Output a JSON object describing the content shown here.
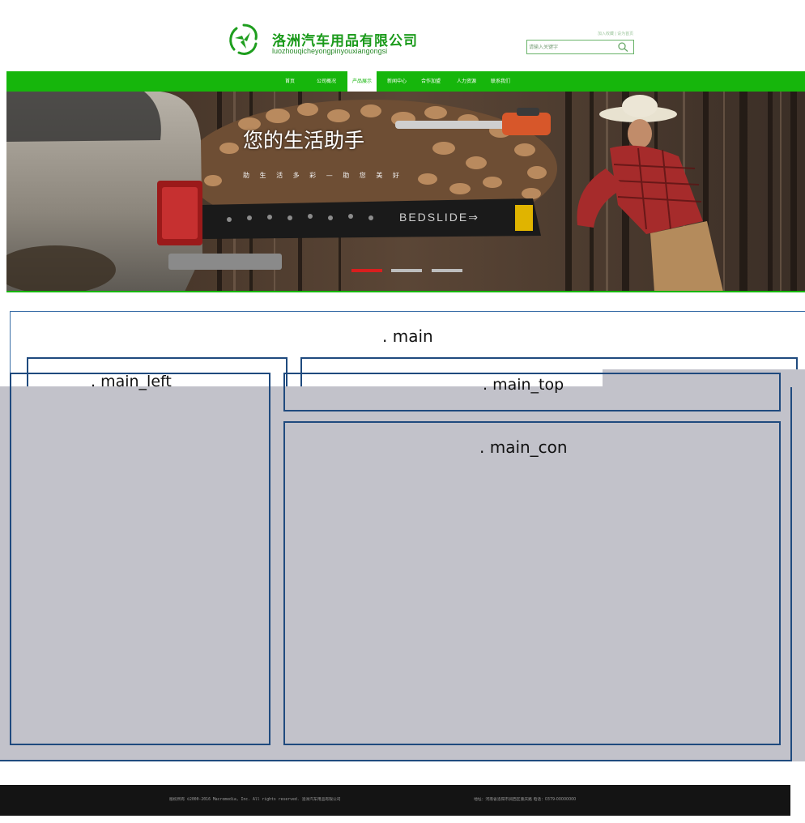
{
  "header": {
    "company_name": "洛洲汽车用品有限公司",
    "company_pinyin": "luozhouqicheyongpinyouxiangongsi",
    "top_link": "加入收藏 | 设为首页",
    "search": {
      "placeholder": "请输入关键字",
      "button_icon": "search-icon"
    },
    "logo_icon": "swirl-logo-icon"
  },
  "nav": {
    "items": [
      {
        "label": "首页"
      },
      {
        "label": "公司概况"
      },
      {
        "label": "产品展示",
        "active": true
      },
      {
        "label": "新闻中心"
      },
      {
        "label": "合作加盟"
      },
      {
        "label": "人力资源"
      },
      {
        "label": "联系我们"
      }
    ]
  },
  "banner": {
    "title": "您的生活助手",
    "subtitle": "助 生 活 多 彩 — 助 您 美 好",
    "brand_text": "BEDSLIDE",
    "slide_count": 3,
    "active_slide": 1
  },
  "layout_labels": {
    "main": ". main",
    "main_left": ". main_left",
    "main_top": ". main_top",
    "main_con": ". main_con"
  },
  "footer": {
    "copyright": "版权所有 ©2000-2016 Macromedia, Inc. All rights reserved. 洛洲汽车用品有限公司",
    "contact": "地址：河南省洛阳市涧西区重庆路  电话：0379-00000000"
  },
  "colors": {
    "brand_green": "#16b60c",
    "box_border": "#1f4a7e",
    "overlay_gray": "#c2c2ca",
    "footer_bg": "#141414",
    "active_dot": "#d91e1e",
    "inactive_dot": "#bdbdbd"
  }
}
